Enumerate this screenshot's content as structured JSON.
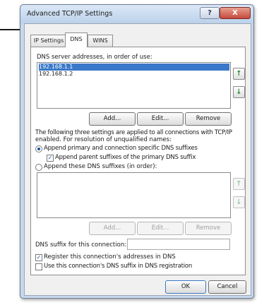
{
  "window": {
    "title": "Advanced TCP/IP Settings",
    "help_glyph": "?",
    "close_glyph": "X"
  },
  "tabs": [
    {
      "label": "IP Settings",
      "active": false
    },
    {
      "label": "DNS",
      "active": true
    },
    {
      "label": "WINS",
      "active": false
    }
  ],
  "dns": {
    "servers_label": "DNS server addresses, in order of use:",
    "servers": [
      "192.168.1.1",
      "192.168.1.2"
    ],
    "add_label": "Add...",
    "edit_label": "Edit...",
    "remove_label": "Remove",
    "up_glyph": "↑",
    "down_glyph": "↓",
    "info_line1": "The following three settings are applied to all connections with TCP/IP",
    "info_line2": "enabled. For resolution of unqualified names:",
    "radio_primary_label": "Append primary and connection specific DNS suffixes",
    "radio_primary_selected": true,
    "check_parent_label": "Append parent suffixes of the primary DNS suffix",
    "check_parent_checked": true,
    "radio_these_label": "Append these DNS suffixes (in order):",
    "radio_these_selected": false,
    "suffix_add_label": "Add...",
    "suffix_edit_label": "Edit...",
    "suffix_remove_label": "Remove",
    "connection_suffix_label": "DNS suffix for this connection:",
    "connection_suffix_value": "",
    "register_label": "Register this connection's addresses in DNS",
    "register_checked": true,
    "use_suffix_label": "Use this connection's DNS suffix in DNS registration",
    "use_suffix_checked": false
  },
  "footer": {
    "ok_label": "OK",
    "cancel_label": "Cancel"
  },
  "colors": {
    "titlebar": "#c7d8ec",
    "close_button": "#c4493b",
    "selection": "#3a78c9",
    "arrow_green": "#2e8b3a"
  },
  "icons": [
    "help-icon",
    "close-icon",
    "arrow-up-icon",
    "arrow-down-icon",
    "callout-arrow-icon"
  ]
}
